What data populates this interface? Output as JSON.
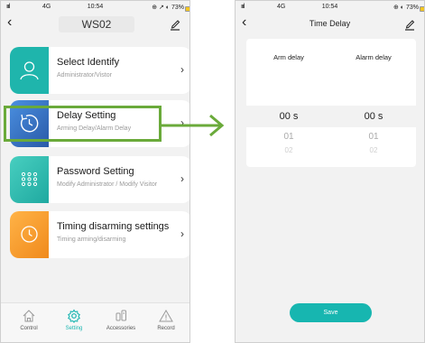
{
  "left_screen": {
    "status": {
      "signal": "ıııl",
      "network": "4G",
      "time": "10:54",
      "right": "⊕ ↗ ◐ 73%"
    },
    "nav": {
      "back": "‹",
      "title": "WS02"
    },
    "cards": [
      {
        "title": "Select Identify",
        "subtitle": "Administrator/Vistor",
        "chevron": "›",
        "icon": "user-icon",
        "color": "#1fb5ac"
      },
      {
        "title": "Delay Setting",
        "subtitle": "Arming Delay/Alarm Delay",
        "chevron": "›",
        "icon": "delay-clock-icon",
        "color": "#3a73c8"
      },
      {
        "title": "Password Setting",
        "subtitle": "Modify Administrator / Modify Visitor",
        "chevron": "›",
        "icon": "keypad-icon",
        "color": "#1fb5ac"
      },
      {
        "title": "Timing disarming settings",
        "subtitle": "Timing arming/disarming",
        "chevron": "›",
        "icon": "clock-icon",
        "color": "#f5a623"
      }
    ],
    "tabs": [
      {
        "label": "Control",
        "icon": "home-icon"
      },
      {
        "label": "Setting",
        "icon": "gear-icon",
        "active": true
      },
      {
        "label": "Accessories",
        "icon": "accessories-icon"
      },
      {
        "label": "Record",
        "icon": "warning-icon"
      }
    ]
  },
  "right_screen": {
    "status": {
      "signal": "ıııl",
      "network": "4G",
      "time": "10:54",
      "right": "⊕ ◐ 73%"
    },
    "nav": {
      "back": "‹",
      "title": "Time Delay"
    },
    "columns": [
      {
        "header": "Arm delay",
        "selected": "00 s",
        "next": "01",
        "next2": "02"
      },
      {
        "header": "Alarm delay",
        "selected": "00 s",
        "next": "01",
        "next2": "02"
      }
    ],
    "save_label": "Save"
  },
  "colors": {
    "accent": "#17b6b0",
    "highlight": "#6aaa3a",
    "delay_icon": "#3a73c8",
    "timing_icon": "#f5a623"
  }
}
